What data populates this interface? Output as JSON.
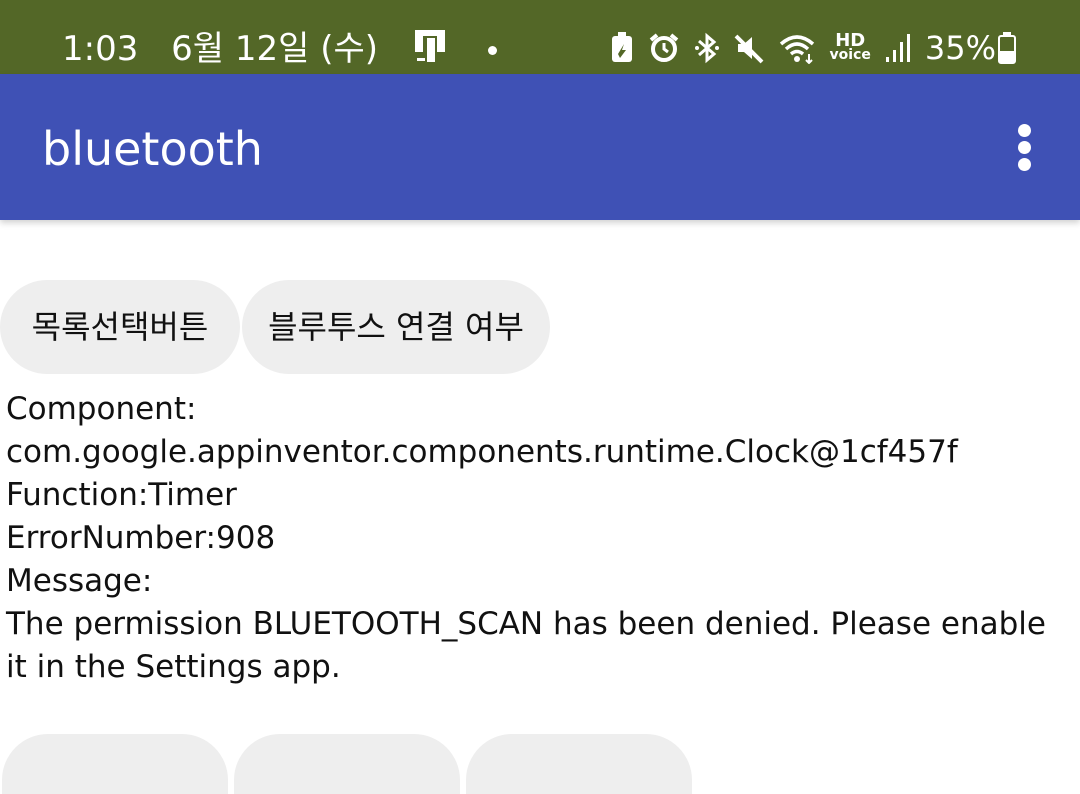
{
  "status_bar": {
    "time": "1:03",
    "date": "6월 12일 (수)",
    "battery_percent": "35%",
    "network_label": "HD",
    "network_sublabel": "voice",
    "icons": [
      "notification-phone-icon",
      "dot-icon",
      "battery-saver-icon",
      "alarm-icon",
      "bluetooth-icon",
      "mute-icon",
      "wifi-icon",
      "signal-icon",
      "battery-icon"
    ]
  },
  "app_bar": {
    "title": "bluetooth",
    "overflow_icon": "more-vert-icon"
  },
  "buttons": {
    "list_select": "목록선택버튼",
    "bt_connected": "블루투스 연결 여부"
  },
  "error": {
    "line1": "Component:",
    "line2": "com.google.appinventor.components.runtime.Clock@1cf457f",
    "line3": "Function:Timer",
    "line4": "ErrorNumber:908",
    "line5": "Message:",
    "line6": "The permission BLUETOOTH_SCAN has been denied. Please enable it in the Settings app."
  },
  "colors": {
    "status_bar_bg": "#536727",
    "app_bar_bg": "#3f51b5",
    "button_bg": "#eeeeee"
  }
}
